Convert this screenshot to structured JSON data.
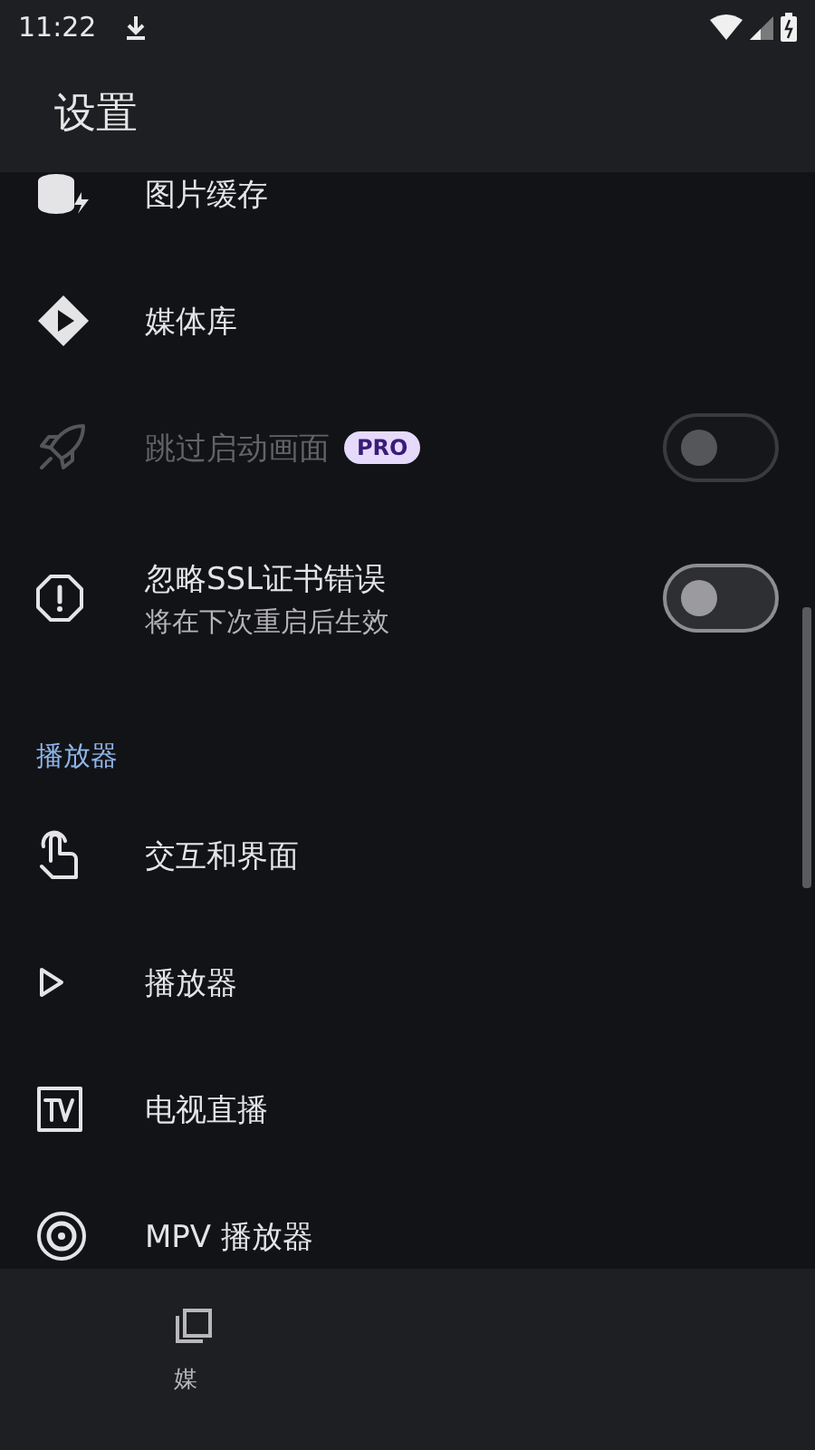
{
  "status_bar": {
    "time": "11:22"
  },
  "app_bar": {
    "title": "设置"
  },
  "items": [
    {
      "kind": "nav",
      "title": "图片缓存"
    },
    {
      "kind": "nav",
      "title": "媒体库"
    },
    {
      "kind": "toggle",
      "title": "跳过启动画面",
      "badge": "PRO",
      "disabled": true,
      "on": false
    },
    {
      "kind": "toggle",
      "title": "忽略SSL证书错误",
      "subtitle": "将在下次重启后生效",
      "disabled": false,
      "on": false
    },
    {
      "kind": "header",
      "title": "播放器"
    },
    {
      "kind": "nav",
      "title": "交互和界面"
    },
    {
      "kind": "nav",
      "title": "播放器"
    },
    {
      "kind": "nav",
      "title": "电视直播"
    },
    {
      "kind": "nav",
      "title": "MPV 播放器"
    }
  ],
  "bottom_nav": {
    "items": [
      {
        "label": "媒"
      }
    ]
  }
}
